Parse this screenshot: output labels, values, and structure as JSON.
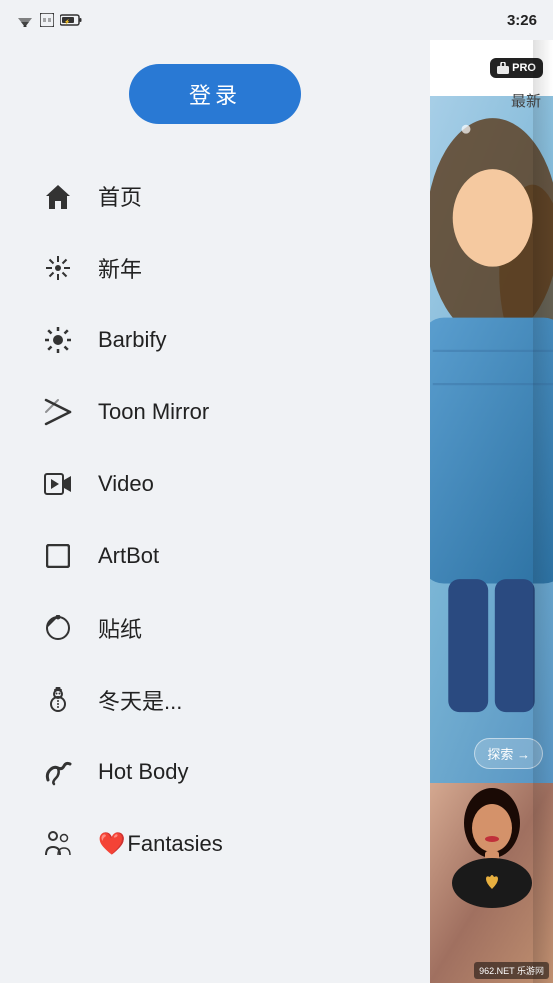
{
  "statusBar": {
    "time": "3:26"
  },
  "drawer": {
    "loginButton": "登录",
    "navItems": [
      {
        "id": "home",
        "icon": "🏠",
        "label": "首页",
        "iconType": "home"
      },
      {
        "id": "new-year",
        "icon": "✨",
        "label": "新年",
        "iconType": "fireworks"
      },
      {
        "id": "barbify",
        "icon": "✳",
        "label": "Barbify",
        "iconType": "star8"
      },
      {
        "id": "toon-mirror",
        "icon": "⚡",
        "label": "Toon Mirror",
        "iconType": "magic"
      },
      {
        "id": "video",
        "icon": "▶",
        "label": "Video",
        "iconType": "video"
      },
      {
        "id": "artbot",
        "icon": "⬜",
        "label": "ArtBot",
        "iconType": "square"
      },
      {
        "id": "stickers",
        "icon": "🌙",
        "label": "贴纸",
        "iconType": "sticker"
      },
      {
        "id": "winter",
        "icon": "⛄",
        "label": "冬天是...",
        "iconType": "winter"
      },
      {
        "id": "hot-body",
        "icon": "💪",
        "label": "Hot Body",
        "iconType": "arm"
      },
      {
        "id": "fantasies",
        "icon": "👥",
        "label": "Fantasies",
        "iconType": "people",
        "heart": true
      }
    ]
  },
  "rightPanel": {
    "proBadgeLabel": "PRO",
    "latestLabel": "最新",
    "exploreLabel": "探索 →"
  }
}
